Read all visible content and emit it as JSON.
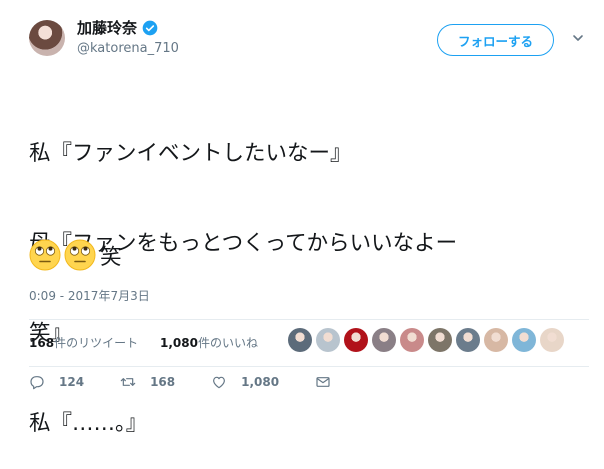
{
  "user": {
    "display_name": "加藤玲奈",
    "handle": "@katorena_710",
    "verified": true
  },
  "follow_button": {
    "label": "フォローする"
  },
  "tweet": {
    "lines": [
      "私『ファンイベントしたいなー』",
      "母『ファンをもっとつくってからいいなよー",
      "笑』",
      "私『……。』"
    ],
    "emoji": [
      "eye-roll-emoji",
      "eye-roll-emoji"
    ],
    "emoji_suffix": "笑",
    "timestamp": "0:09 - 2017年7月3日"
  },
  "stats": {
    "retweets_count": "168",
    "retweets_label": "件のリツイート",
    "likes_count": "1,080",
    "likes_label": "件のいいね",
    "liker_avatars": [
      "#5c6b7a",
      "#b8c4ce",
      "#b1121a",
      "#8a7f86",
      "#c98a8a",
      "#7d7568",
      "#6b7c8c",
      "#d7b8a4",
      "#7fb6d8",
      "#e8d6c8"
    ]
  },
  "actions": {
    "reply_count": "124",
    "retweet_count": "168",
    "like_count": "1,080"
  },
  "colors": {
    "accent": "#1da1f2",
    "text": "#14171a",
    "muted": "#657786",
    "border": "#e6ecf0"
  }
}
